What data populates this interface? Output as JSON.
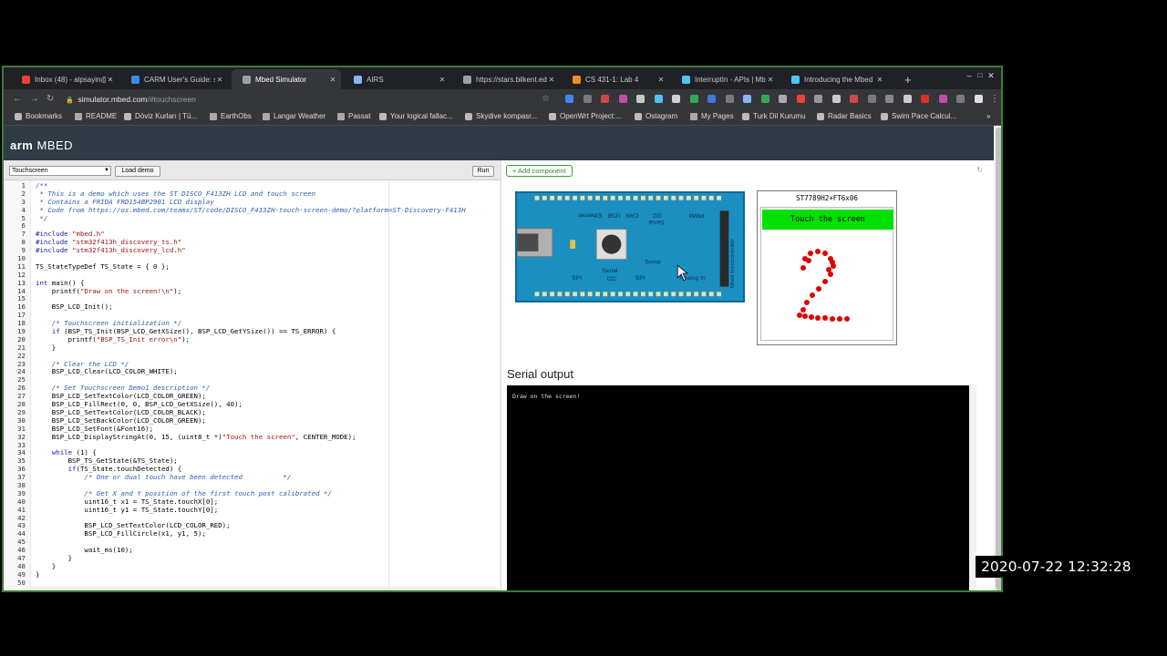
{
  "browser": {
    "tabs": [
      {
        "title": "Inbox (48) - alpsayin@",
        "color": "#ea4335",
        "active": false
      },
      {
        "title": "CARM User's Guide: st",
        "color": "#4285f4",
        "active": false
      },
      {
        "title": "Mbed Simulator",
        "color": "#9aa0a6",
        "active": true
      },
      {
        "title": "AIRS",
        "color": "#8ab4f8",
        "active": false
      },
      {
        "title": "https://stars.bilkent.ed",
        "color": "#9aa0a6",
        "active": false
      },
      {
        "title": "CS 431-1: Lab 4",
        "color": "#f28b24",
        "active": false
      },
      {
        "title": "InterruptIn - APIs | Mb",
        "color": "#4fc3f7",
        "active": false
      },
      {
        "title": "Introducing the Mbed",
        "color": "#4fc3f7",
        "active": false
      }
    ],
    "new_tab": "+",
    "window_controls": {
      "minimize": "–",
      "maximize": "□",
      "close": "✕"
    },
    "url_host": "simulator.mbed.com",
    "url_path": "/#touchscreen",
    "bookmarks": [
      "Bookmarks",
      "README",
      "Döviz Kurları | Tü...",
      "EarthObs",
      "Langar Weather",
      "Passat",
      "Your logical fallac...",
      "Skydive kompasr...",
      "OpenWrt Project:...",
      "Ostagram",
      "My Pages",
      "Turk Dil Kurumu",
      "Radar Basics",
      "Swim Pace Calcul..."
    ],
    "bookmarks_more": "»"
  },
  "app": {
    "logo_arm": "arm",
    "logo_mbed": "MBED",
    "demo_select_value": "Touchscreen",
    "load_demo_label": "Load demo",
    "run_label": "Run",
    "add_component_label": "+ Add component",
    "serial_output_title": "Serial output",
    "serial_output_text": "Draw on the screen!"
  },
  "lcd": {
    "title": "ST7789H2+FT6x06",
    "banner": "Touch the screen",
    "ink_color": "#e00000"
  },
  "board": {
    "labels": {
      "ethernet": "Ethernet",
      "usb": "USB",
      "can": "CAN",
      "i2c_top": "I2C",
      "serial_top": "Serial",
      "pwm": "PWM",
      "spi_left": "SPI",
      "serial_mid": "Serial",
      "i2c_bot": "I2C",
      "spi_mid": "SPI",
      "serial_right": "Serial",
      "analog_in": "Analog In",
      "url": "http://mbed.org",
      "side": "Mbed microcontroller"
    }
  },
  "code_lines": [
    "/**",
    " * This is a demo which uses the ST DISCO_F413ZH LCD and touch screen",
    " * Contains a FRIDA FRD154BP2901 LCD display",
    " * Code from https://os.mbed.com/teams/ST/code/DISCO_F413ZH-touch-screen-demo/?platform=ST-Discovery-F413H",
    " */",
    "",
    "#include \"mbed.h\"",
    "#include \"stm32f413h_discovery_ts.h\"",
    "#include \"stm32f413h_discovery_lcd.h\"",
    "",
    "TS_StateTypeDef TS_State = { 0 };",
    "",
    "int main() {",
    "    printf(\"Draw on the screen!\\n\");",
    "",
    "    BSP_LCD_Init();",
    "",
    "    /* Touchscreen initialization */",
    "    if (BSP_TS_Init(BSP_LCD_GetXSize(), BSP_LCD_GetYSize()) == TS_ERROR) {",
    "        printf(\"BSP_TS_Init error\\n\");",
    "    }",
    "",
    "    /* Clear the LCD */",
    "    BSP_LCD_Clear(LCD_COLOR_WHITE);",
    "",
    "    /* Set Touchscreen Demo1 description */",
    "    BSP_LCD_SetTextColor(LCD_COLOR_GREEN);",
    "    BSP_LCD_FillRect(0, 0, BSP_LCD_GetXSize(), 40);",
    "    BSP_LCD_SetTextColor(LCD_COLOR_BLACK);",
    "    BSP_LCD_SetBackColor(LCD_COLOR_GREEN);",
    "    BSP_LCD_SetFont(&Font16);",
    "    BSP_LCD_DisplayStringAt(0, 15, (uint8_t *)\"Touch the screen\", CENTER_MODE);",
    "",
    "    while (1) {",
    "        BSP_TS_GetState(&TS_State);",
    "        if(TS_State.touchDetected) {",
    "            /* One or dual touch have been detected          */",
    "",
    "            /* Get X and Y position of the first touch post calibrated */",
    "            uint16_t x1 = TS_State.touchX[0];",
    "            uint16_t y1 = TS_State.touchY[0];",
    "",
    "            BSP_LCD_SetTextColor(LCD_COLOR_RED);",
    "            BSP_LCD_FillCircle(x1, y1, 5);",
    "",
    "            wait_ms(10);",
    "        }",
    "    }",
    "}",
    ""
  ],
  "timestamp": "2020-07-22  12:32:28"
}
